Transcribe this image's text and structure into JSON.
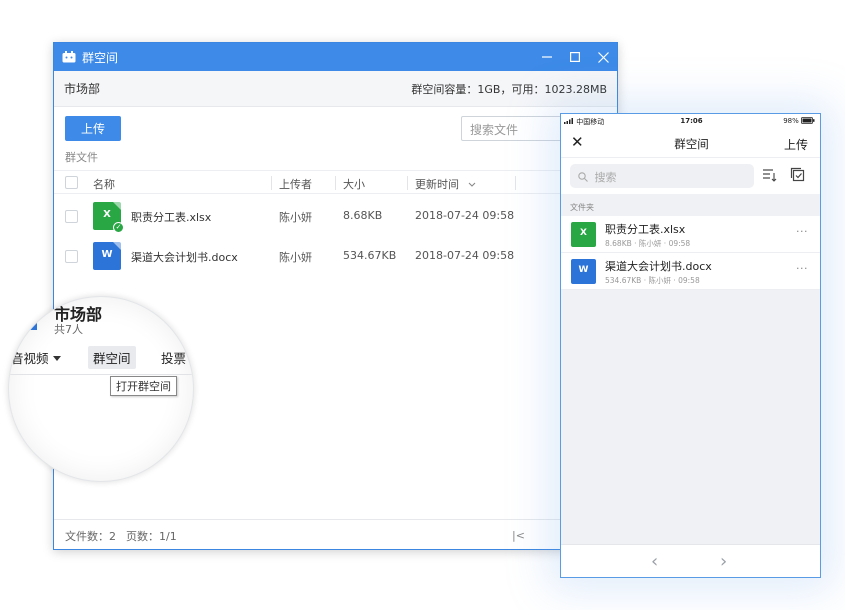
{
  "desktop": {
    "window_title": "群空间",
    "group_name": "市场部",
    "capacity_text": "群空间容量：1GB，可用：1023.28MB",
    "upload_label": "上传",
    "search_placeholder": "搜索文件",
    "section_label": "群文件",
    "columns": {
      "name": "名称",
      "uploader": "上传者",
      "size": "大小",
      "updated": "更新时间"
    },
    "files": [
      {
        "name": "职责分工表.xlsx",
        "uploader": "陈小妍",
        "size": "8.68KB",
        "updated": "2018-07-24 09:58",
        "type": "xlsx",
        "icon_glyph": "X"
      },
      {
        "name": "渠道大会计划书.docx",
        "uploader": "陈小妍",
        "size": "534.67KB",
        "updated": "2018-07-24 09:58",
        "type": "docx",
        "icon_glyph": "W"
      }
    ],
    "footer": {
      "file_count": "文件数：2",
      "page_count": "页数：1/1",
      "first_page": "|<"
    }
  },
  "magnifier": {
    "group_title": "市场部",
    "member_count": "共7人",
    "tabs": [
      "音视频",
      "群空间",
      "投票"
    ],
    "active_tab": "群空间",
    "tooltip": "打开群空间"
  },
  "phone": {
    "status": {
      "carrier": "中国移动",
      "time": "17:06",
      "battery": "98%"
    },
    "nav": {
      "close": "✕",
      "title": "群空间",
      "action": "上传"
    },
    "search_placeholder": "搜索",
    "section_label": "文件夹",
    "files": [
      {
        "name": "职责分工表.xlsx",
        "meta": "8.68KB · 陈小妍 · 09:58",
        "type": "xlsx",
        "icon_glyph": "X",
        "more": "···"
      },
      {
        "name": "渠道大会计划书.docx",
        "meta": "534.67KB · 陈小妍 · 09:58",
        "type": "docx",
        "icon_glyph": "W",
        "more": "···"
      }
    ],
    "bottom": {
      "back": "‹",
      "forward": "›"
    }
  },
  "colors": {
    "accent": "#3d8ae8",
    "excel": "#29a745",
    "word": "#2c74d8"
  }
}
